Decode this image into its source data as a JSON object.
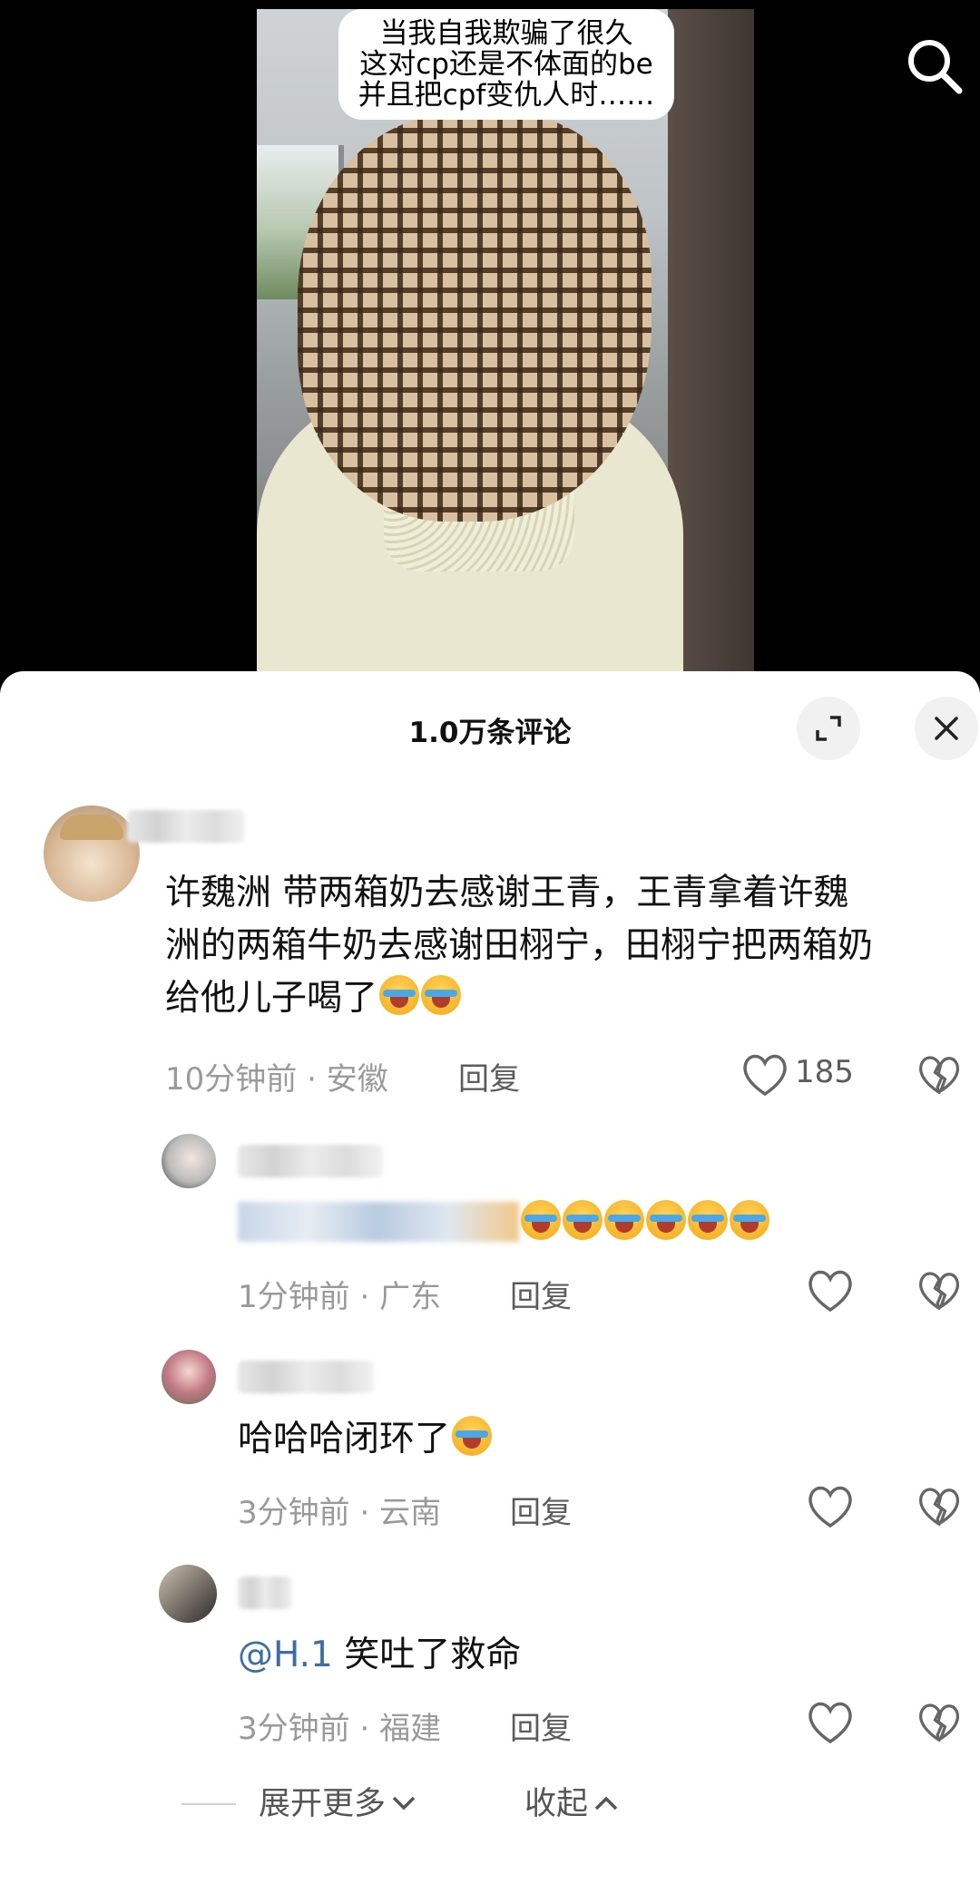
{
  "video": {
    "caption_lines": [
      "当我自我欺骗了很久",
      "这对cp还是不体面的be",
      "并且把cpf变仇人时……"
    ]
  },
  "panel": {
    "title": "1.0万条评论"
  },
  "comments": [
    {
      "text_lines": [
        "许魏洲  带两箱奶去感谢王青，王青拿着许魏",
        "洲的两箱牛奶去感谢田栩宁，田栩宁把两箱奶",
        "给他儿子喝了"
      ],
      "time": "10分钟前",
      "location": "安徽",
      "reply_label": "回复",
      "likes": "185"
    }
  ],
  "replies": [
    {
      "text": "",
      "time": "1分钟前",
      "location": "广东",
      "reply_label": "回复"
    },
    {
      "text": "哈哈哈闭环了",
      "time": "3分钟前",
      "location": "云南",
      "reply_label": "回复"
    },
    {
      "mention": "@H.1",
      "text": " 笑吐了救命",
      "time": "3分钟前",
      "location": "福建",
      "reply_label": "回复"
    }
  ],
  "footer": {
    "expand_more": "展开更多",
    "collapse": "收起"
  },
  "icons": {
    "search": "search-icon",
    "expand": "expand-icon",
    "close": "close-icon",
    "like": "heart-icon",
    "dislike": "broken-heart-icon",
    "chevron_down": "chevron-down-icon",
    "chevron_up": "chevron-up-icon"
  }
}
